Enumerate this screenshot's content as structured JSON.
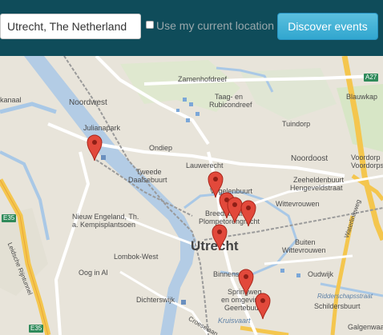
{
  "search": {
    "value": "Utrecht, The Netherland"
  },
  "location_option": {
    "label": "Use my current location",
    "checked": false
  },
  "discover_button": {
    "label": "Discover events"
  },
  "map": {
    "city_label": "Utrecht",
    "labels": {
      "zamenhofdreef": "Zamenhofdreef",
      "taag": "Taag- en",
      "rubicondreef": "Rubicondreef",
      "blauwkap": "Blauwkap",
      "noordwest": "Noordwest",
      "kanaal": "kanaal",
      "tuindorp": "Tuindorp",
      "julianapark": "Julianapark",
      "ondiep": "Ondiep",
      "noordoost": "Noordoost",
      "voordorp": "Voordorp",
      "voordorpse": "Voordorpse",
      "lauwerecht": "Lauwerecht",
      "tweede": "Tweede",
      "daalsebuurt": "Daalsebuurt",
      "zeeheldenbuurt": "Zeeheldenbuurt",
      "hengeveldstraat": "Hengeveldstraat",
      "vogelenbuurt": "Vogelenbuurt",
      "wittevrouwen": "Wittevrouwen",
      "breedstraat": "Breedstraat",
      "plompetorengracht": "Plompetorengracht",
      "nieuw_engeland": "Nieuw Engeland, Th.",
      "kempisplantsoen": "a. Kempisplantsoen",
      "buiten": "Buiten",
      "buiten_wittevrouwen": "Wittevrouwen",
      "lombok_west": "Lombok-West",
      "oog_in_al": "Oog in Al",
      "binnenstad": "Binnenstad",
      "oudwijk": "Oudwijk",
      "waterlinieweg": "Waterlinieweg",
      "springweg": "Springweg",
      "en_omgeving": "en omgeving",
      "geertebuurt": "Geertebuurt",
      "dichterswijk": "Dichterswijk",
      "croeselaan": "Croeselaan",
      "kruisvaart": "Kruisvaart",
      "riddersch": "Ridderschapsstraat",
      "schildersbuurt": "Schildersbuurt",
      "galgenwaard": "Galgenwaard",
      "leidsche_rijn": "Leidsche Rijntunnel"
    },
    "badges": {
      "a27": "A27",
      "e35_top": "E35",
      "e35_bottom": "E35"
    }
  }
}
